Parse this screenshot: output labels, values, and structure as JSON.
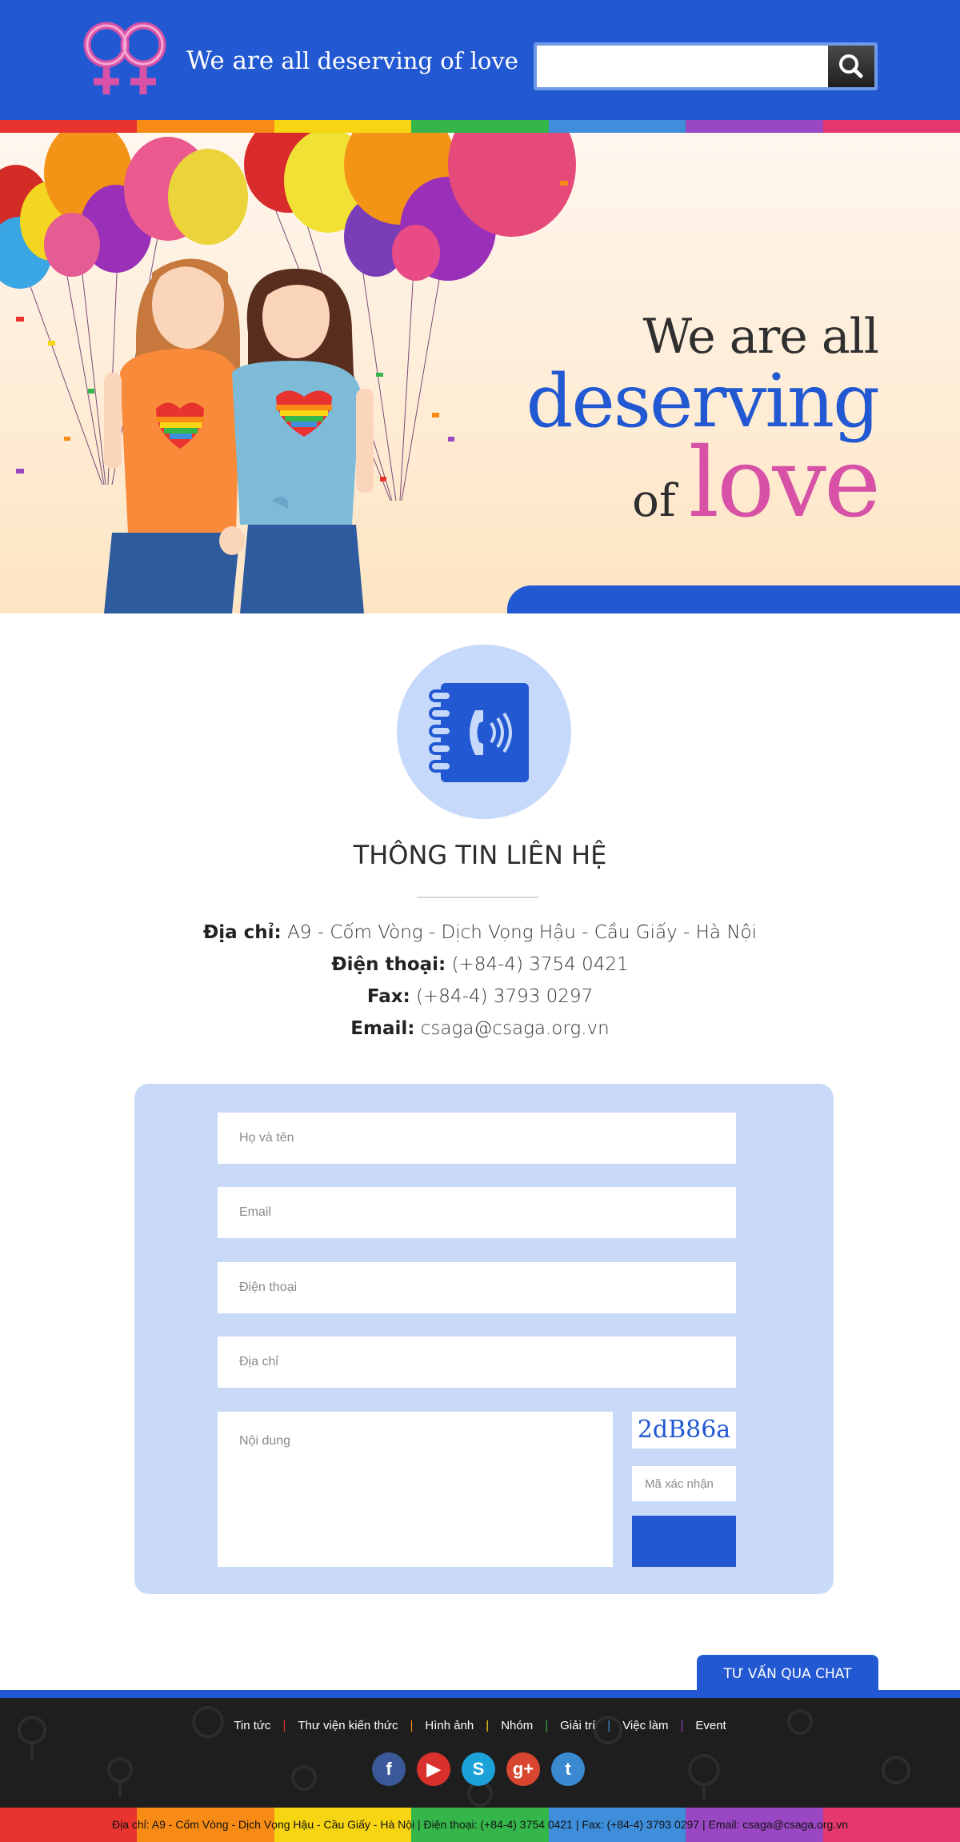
{
  "header": {
    "tagline_part1": "We are",
    "tagline_part2": "all deserving of love",
    "search": {
      "placeholder": "",
      "button_icon": "search-icon"
    }
  },
  "rainbow_colors": [
    "#e8332f",
    "#f88b16",
    "#f7d512",
    "#35b64a",
    "#3e8edb",
    "#9a47c3",
    "#e4386f"
  ],
  "hero": {
    "line1": "We are all",
    "line2": "deserving",
    "line3_of": "of",
    "line3_love": "love"
  },
  "contact": {
    "icon": "phone-book-icon",
    "title": "THÔNG TIN LIÊN HỆ",
    "address_label": "Địa chỉ:",
    "address_value": "A9 - Cốm Vòng - Dịch Vọng Hậu - Cầu Giấy - Hà Nội",
    "phone_label": "Điện thoại:",
    "phone_value": "(+84-4) 3754 0421",
    "fax_label": "Fax:",
    "fax_value": "(+84-4) 3793 0297",
    "email_label": "Email:",
    "email_value": "csaga@csaga.org.vn"
  },
  "form": {
    "name_placeholder": "Họ và tên",
    "email_placeholder": "Email",
    "phone_placeholder": "Điện thoại",
    "address_placeholder": "Địa chỉ",
    "content_placeholder": "Nội dung",
    "captcha_text": "2dB86a",
    "captcha_placeholder": "Mã xác nhận"
  },
  "chat_button": "TƯ VẤN QUA CHAT",
  "footer": {
    "nav": [
      {
        "label": "Tin tức",
        "sep_color": "#e8332f"
      },
      {
        "label": "Thư viện kiến thức",
        "sep_color": "#f88b16"
      },
      {
        "label": "Hình ảnh",
        "sep_color": "#f7d512"
      },
      {
        "label": "Nhóm",
        "sep_color": "#35b64a"
      },
      {
        "label": "Giải trí",
        "sep_color": "#3e8edb"
      },
      {
        "label": "Việc làm",
        "sep_color": "#9a47c3"
      },
      {
        "label": "Event",
        "sep_color": ""
      }
    ],
    "socials": [
      {
        "name": "facebook-icon",
        "glyph": "f",
        "color": "#3b5998"
      },
      {
        "name": "youtube-icon",
        "glyph": "▶",
        "color": "#d9302c"
      },
      {
        "name": "skype-icon",
        "glyph": "S",
        "color": "#1ba3d9"
      },
      {
        "name": "google-plus-icon",
        "glyph": "g+",
        "color": "#d9462f"
      },
      {
        "name": "twitter-icon",
        "glyph": "t",
        "color": "#3b89d1"
      }
    ],
    "bottom_text": "Địa chỉ: A9 - Cốm Vòng - Dịch Vọng Hậu - Cầu Giấy - Hà Nội  |  Điện thoại: (+84-4) 3754 0421  |  Fax: (+84-4) 3793 0297  |  Email: csaga@csaga.org.vn"
  }
}
